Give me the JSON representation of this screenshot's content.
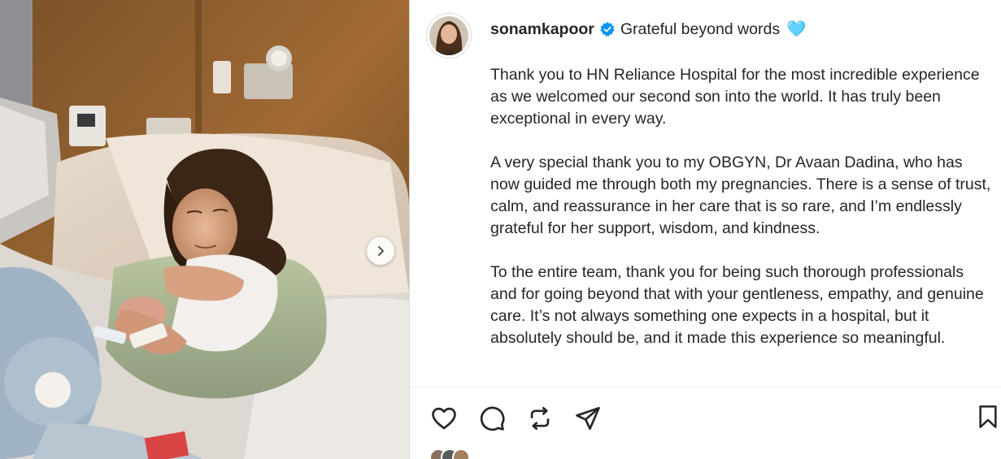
{
  "post": {
    "username": "sonamkapoor",
    "caption_first_line": "Grateful beyond words",
    "heart_emoji": "🩵",
    "paragraphs": [
      "Thank you to HN Reliance Hospital for the most incredible experience as we welcomed our second son into the world. It has truly been exceptional in every way.",
      "A very special thank you to my OBGYN, Dr Avaan Dadina, who has now guided me through both my pregnancies. There is a sense of trust, calm, and reassurance in her care that is so rare, and I’m endlessly grateful for her support, wisdom, and kindness.",
      "To the entire team, thank you for being such thorough professionals and for going beyond that with your gentleness, empathy, and genuine care. It’s not always something one expects in a hospital, but it absolutely should be, and it made this experience so meaningful."
    ]
  },
  "icons": {
    "verified": "verified-badge-icon",
    "next": "chevron-right-icon",
    "like": "heart-icon",
    "comment": "comment-bubble-icon",
    "repost": "repost-icon",
    "share": "paper-plane-icon",
    "save": "bookmark-icon"
  },
  "colors": {
    "verified_blue": "#0095f6",
    "text": "#262626",
    "heart_emoji_tint": "#c8b8e8"
  }
}
